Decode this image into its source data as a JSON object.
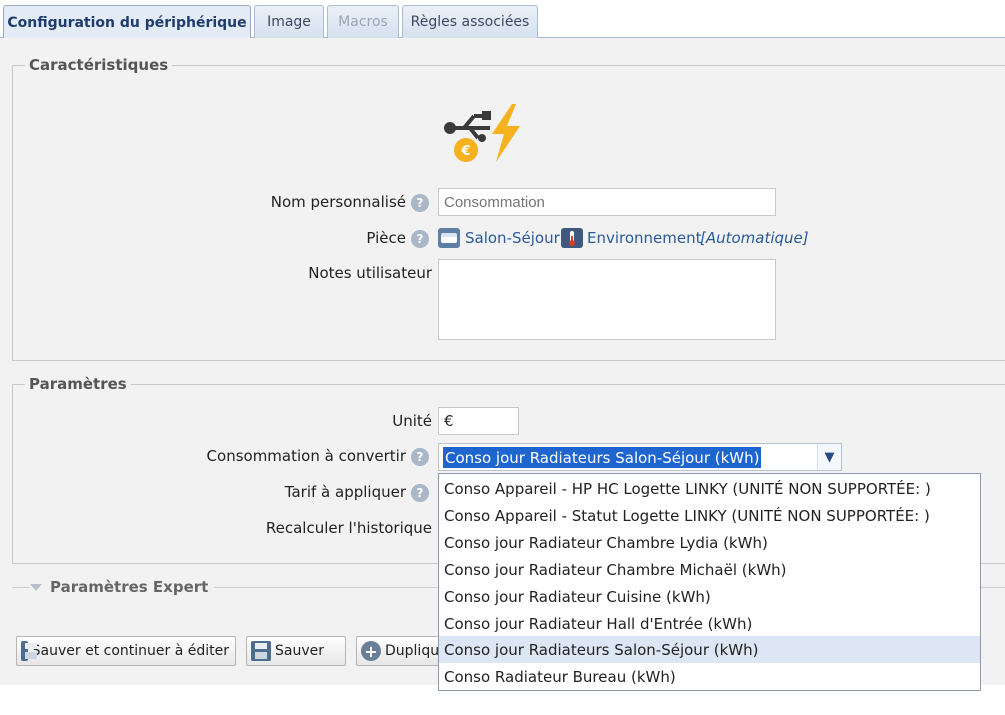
{
  "tabs": [
    {
      "label": "Configuration du périphérique",
      "state": "active"
    },
    {
      "label": "Image",
      "state": "normal"
    },
    {
      "label": "Macros",
      "state": "disabled"
    },
    {
      "label": "Règles associées",
      "state": "normal"
    }
  ],
  "characteristics": {
    "legend": "Caractéristiques",
    "device_icon": "usb-energy-euro-icon",
    "name_label": "Nom personnalisé",
    "name_placeholder": "Consommation",
    "room_label": "Pièce",
    "room_name": "Salon-Séjour",
    "category_name": "Environnement",
    "category_mode": "[Automatique]",
    "notes_label": "Notes utilisateur",
    "notes_value": ""
  },
  "parameters": {
    "legend": "Paramètres",
    "unit_label": "Unité",
    "unit_value": "€",
    "convert_label": "Consommation à convertir",
    "convert_selected": "Conso jour Radiateurs Salon-Séjour (kWh)",
    "tariff_label": "Tarif à appliquer",
    "recalc_label": "Recalculer l'historique",
    "options": [
      "Conso Appareil - HP HC Logette LINKY (UNITÉ NON SUPPORTÉE: )",
      "Conso Appareil - Statut Logette LINKY (UNITÉ NON SUPPORTÉE: )",
      "Conso jour Radiateur Chambre Lydia (kWh)",
      "Conso jour Radiateur Chambre Michaël (kWh)",
      "Conso jour Radiateur Cuisine (kWh)",
      "Conso jour Radiateur Hall d'Entrée (kWh)",
      "Conso jour Radiateurs Salon-Séjour (kWh)",
      "Conso Radiateur Bureau (kWh)"
    ],
    "highlighted_index": 6
  },
  "expert": {
    "label": "Paramètres Expert"
  },
  "buttons": {
    "save_continue": "Sauver et continuer à éditer",
    "save": "Sauver",
    "duplicate": "Dupliquer"
  },
  "colors": {
    "accent": "#1e65d0",
    "link": "#2a5a9a",
    "panel": "#f2f2f2"
  }
}
